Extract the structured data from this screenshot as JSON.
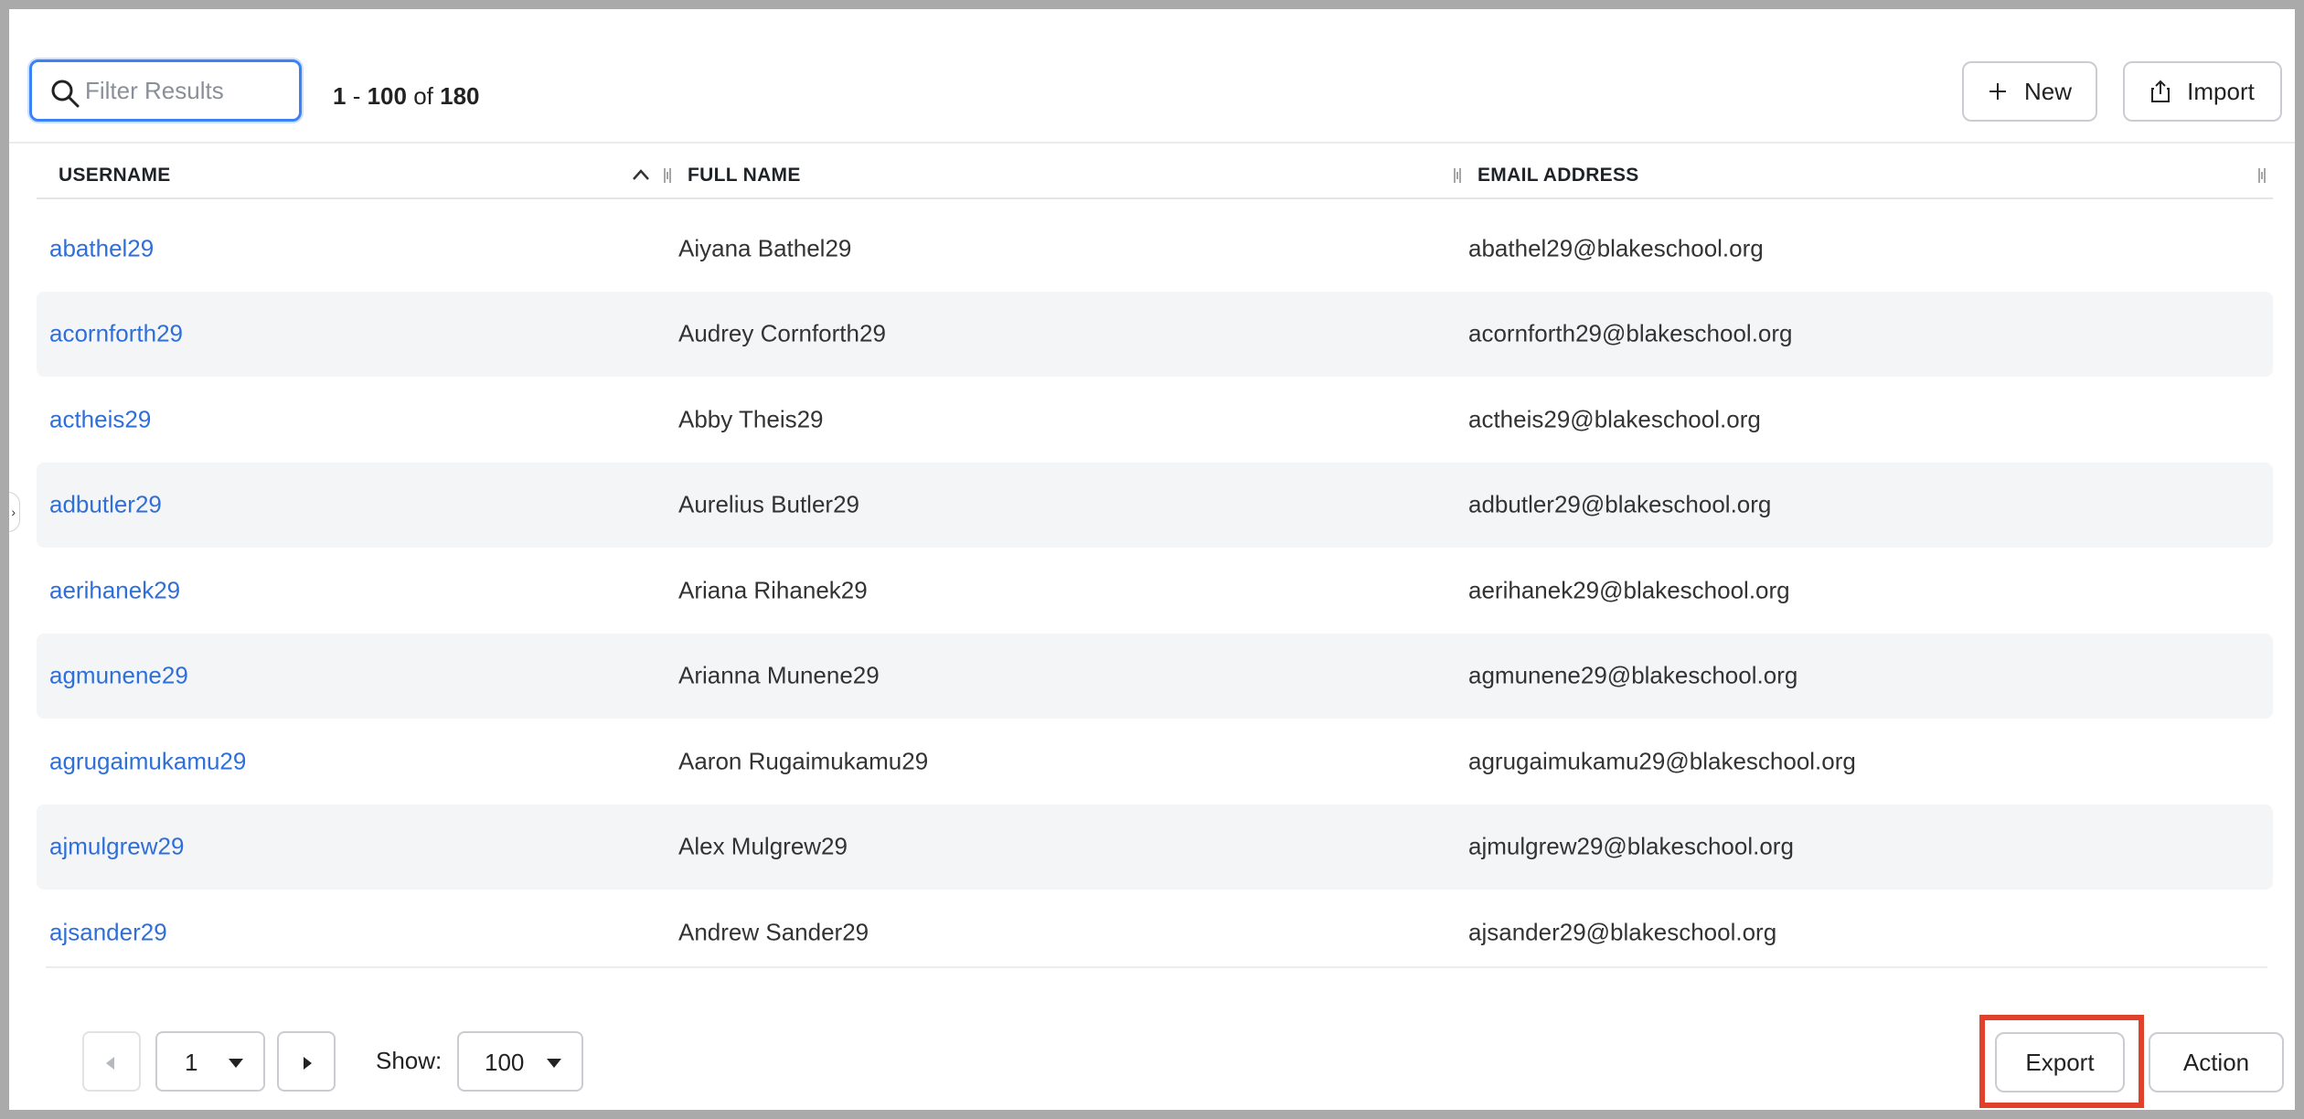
{
  "toolbar": {
    "search_placeholder": "Filter Results",
    "search_value": "",
    "range_start": "1",
    "range_sep": " - ",
    "range_end": "100",
    "range_of": " of ",
    "total": "180",
    "new_label": "New",
    "import_label": "Import"
  },
  "table": {
    "columns": [
      "USERNAME",
      "FULL NAME",
      "EMAIL ADDRESS"
    ],
    "sort_column": "USERNAME",
    "sort_direction": "ascending",
    "rows": [
      {
        "username": "abathel29",
        "full_name": "Aiyana Bathel29",
        "email": "abathel29@blakeschool.org"
      },
      {
        "username": "acornforth29",
        "full_name": "Audrey Cornforth29",
        "email": "acornforth29@blakeschool.org"
      },
      {
        "username": "actheis29",
        "full_name": "Abby Theis29",
        "email": "actheis29@blakeschool.org"
      },
      {
        "username": "adbutler29",
        "full_name": "Aurelius Butler29",
        "email": "adbutler29@blakeschool.org"
      },
      {
        "username": "aerihanek29",
        "full_name": "Ariana Rihanek29",
        "email": "aerihanek29@blakeschool.org"
      },
      {
        "username": "agmunene29",
        "full_name": "Arianna Munene29",
        "email": "agmunene29@blakeschool.org"
      },
      {
        "username": "agrugaimukamu29",
        "full_name": "Aaron Rugaimukamu29",
        "email": "agrugaimukamu29@blakeschool.org"
      },
      {
        "username": "ajmulgrew29",
        "full_name": "Alex Mulgrew29",
        "email": "ajmulgrew29@blakeschool.org"
      },
      {
        "username": "ajsander29",
        "full_name": "Andrew Sander29",
        "email": "ajsander29@blakeschool.org"
      }
    ]
  },
  "footer": {
    "page_value": "1",
    "show_label": "Show:",
    "show_value": "100",
    "export_label": "Export",
    "action_label": "Action"
  },
  "colors": {
    "link": "#2f6fd8",
    "focus_ring": "#3b82f6",
    "highlight_box": "#e0412a",
    "row_alt": "#f4f5f7"
  },
  "icons": {
    "search": "search-icon",
    "new": "plus-icon",
    "import": "upload-icon",
    "sort": "chevron-up-icon",
    "resize": "column-resize-icon",
    "prev": "caret-left-icon",
    "next": "caret-right-icon",
    "dropdown": "caret-down-icon"
  }
}
